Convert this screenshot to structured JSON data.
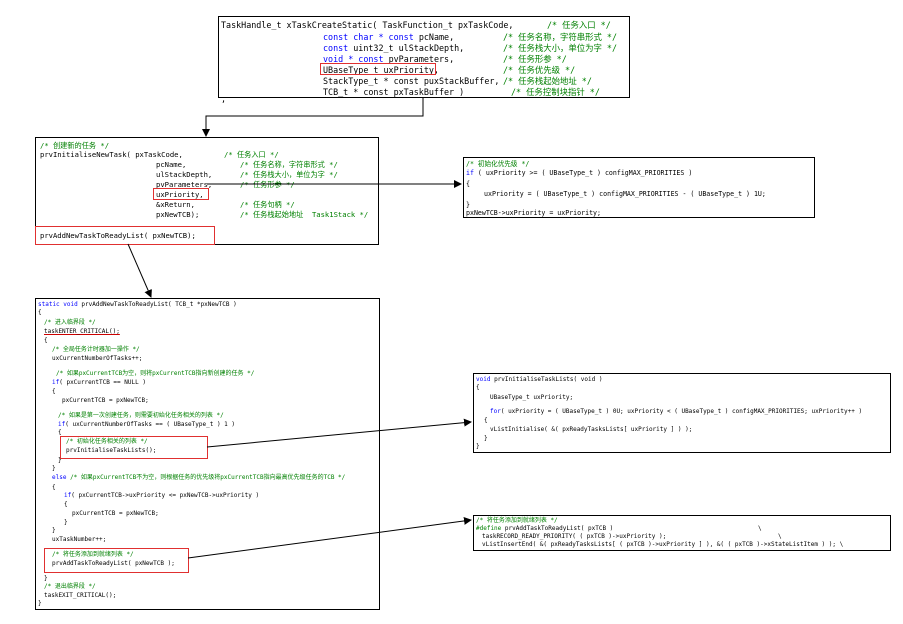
{
  "box1": {
    "lines": [
      {
        "code": "TaskHandle_t xTaskCreateStatic( TaskFunction_t pxTaskCode,",
        "comment": "/* 任务入口 */"
      },
      {
        "pre": "const char * const ",
        "code": "pcName,",
        "comment": "/* 任务名称，字符串形式 */"
      },
      {
        "pre": "const ",
        "code": "uint32_t ulStackDepth,",
        "comment": "/* 任务栈大小，单位为字 */"
      },
      {
        "pre": "void * const ",
        "code": "pvParameters,",
        "comment": "/* 任务形参 */"
      },
      {
        "code": "UBaseType_t uxPriority,",
        "comment": "/* 任务优先级 */"
      },
      {
        "code": "StackType_t * const puxStackBuffer,",
        "comment": "/* 任务栈起始地址 */"
      },
      {
        "code": "TCB_t * const pxTaskBuffer )",
        "comment": "/* 任务控制块指针 */"
      },
      {
        "code": ","
      }
    ]
  },
  "box2": {
    "lines": [
      {
        "comment": "/* 创建新的任务 */"
      },
      {
        "code": "prvInitialiseNewTask( pxTaskCode,",
        "comment": "/* 任务入口 */"
      },
      {
        "code": "pcName,",
        "comment": "/* 任务名称，字符串形式 */"
      },
      {
        "code": "ulStackDepth,",
        "comment": "/* 任务栈大小，单位为字 */"
      },
      {
        "code": "pvParameters,",
        "comment": "/* 任务形参 */"
      },
      {
        "code": "uxPriority,"
      },
      {
        "code": "&xReturn,",
        "comment": "/* 任务句柄 */"
      },
      {
        "code": "pxNewTCB);",
        "comment": "/* 任务栈起始地址  Task1Stack */"
      },
      {
        "code": "prvAddNewTaskToReadyList( pxNewTCB);"
      }
    ]
  },
  "box3": {
    "lines": [
      {
        "comment": "/* 初始化优先级 */"
      },
      {
        "kw": "if",
        "code": " ( uxPriority >= ( UBaseType_t ) configMAX_PRIORITIES )"
      },
      {
        "code": "{"
      },
      {
        "code": "uxPriority = ( UBaseType_t ) configMAX_PRIORITIES - ( UBaseType_t ) 1U;"
      },
      {
        "code": "}"
      },
      {
        "code": "pxNewTCB->uxPriority = uxPriority;"
      }
    ]
  },
  "box4": {
    "lines": [
      {
        "kw": "static void",
        "code": " prvAddNewTaskToReadyList( TCB_t *pxNewTCB )"
      },
      {
        "code": "{"
      },
      {
        "comment": "/* 进入临界段 */"
      },
      {
        "code": "taskENTER_CRITICAL();"
      },
      {
        "code": "{"
      },
      {
        "comment": "/* 全局任务计时器加一操作 */"
      },
      {
        "code": "uxCurrentNumberOfTasks++;"
      },
      {
        "comment": "/* 如果pxCurrentTCB为空，则将pxCurrentTCB指向新创建的任务 */"
      },
      {
        "kw": "if",
        "code": "( pxCurrentTCB == NULL )"
      },
      {
        "code": "{"
      },
      {
        "code": "pxCurrentTCB = pxNewTCB;"
      },
      {
        "comment": "/* 如果是第一次创建任务，则需要初始化任务相关的列表 */"
      },
      {
        "kw": "if",
        "code": "( uxCurrentNumberOfTasks == ( UBaseType_t ) 1 )"
      },
      {
        "code": "{"
      },
      {
        "comment": "/* 初始化任务相关的列表 */"
      },
      {
        "code": "prvInitialiseTaskLists();"
      },
      {
        "code": "}"
      },
      {
        "code": "}"
      },
      {
        "kw": "else",
        "comment": " /* 如果pxCurrentTCB不为空，则根据任务的优先级将pxCurrentTCB指向最高优先级任务的TCB */"
      },
      {
        "code": "{"
      },
      {
        "kw": "if",
        "code": "( pxCurrentTCB->uxPriority <= pxNewTCB->uxPriority )"
      },
      {
        "code": "{"
      },
      {
        "code": "pxCurrentTCB = pxNewTCB;"
      },
      {
        "code": "}"
      },
      {
        "code": "}"
      },
      {
        "code": "uxTaskNumber++;"
      },
      {
        "comment": "/* 将任务添加到就绪列表 */"
      },
      {
        "code": "prvAddTaskToReadyList( pxNewTCB );"
      },
      {
        "code": "}"
      },
      {
        "comment": "/* 退出临界段 */"
      },
      {
        "code": "taskEXIT_CRITICAL();"
      },
      {
        "code": "}"
      }
    ]
  },
  "box5": {
    "lines": [
      {
        "kw": "void",
        "code": " prvInitialiseTaskLists( void )"
      },
      {
        "code": "{"
      },
      {
        "code": "UBaseType_t uxPriority;"
      },
      {
        "kw": "for",
        "code": "( uxPriority = ( UBaseType_t ) 0U; uxPriority < ( UBaseType_t ) configMAX_PRIORITIES; uxPriority++ )"
      },
      {
        "code": "{"
      },
      {
        "code": "vListInitialise( &( pxReadyTasksLists[ uxPriority ] ) );"
      },
      {
        "code": "}"
      },
      {
        "code": "}"
      }
    ]
  },
  "box6": {
    "lines": [
      {
        "comment": "/* 将任务添加到就绪列表 */"
      },
      {
        "kw": "#define",
        "code": " prvAddTaskToReadyList( pxTCB )",
        "tail": "\\"
      },
      {
        "code": "taskRECORD_READY_PRIORITY( ( pxTCB )->uxPriority );",
        "tail": "\\"
      },
      {
        "code": "vListInsertEnd( &( pxReadyTasksLists[ ( pxTCB )->uxPriority ] ), &( ( pxTCB )->xStateListItem ) ); \\"
      }
    ]
  }
}
